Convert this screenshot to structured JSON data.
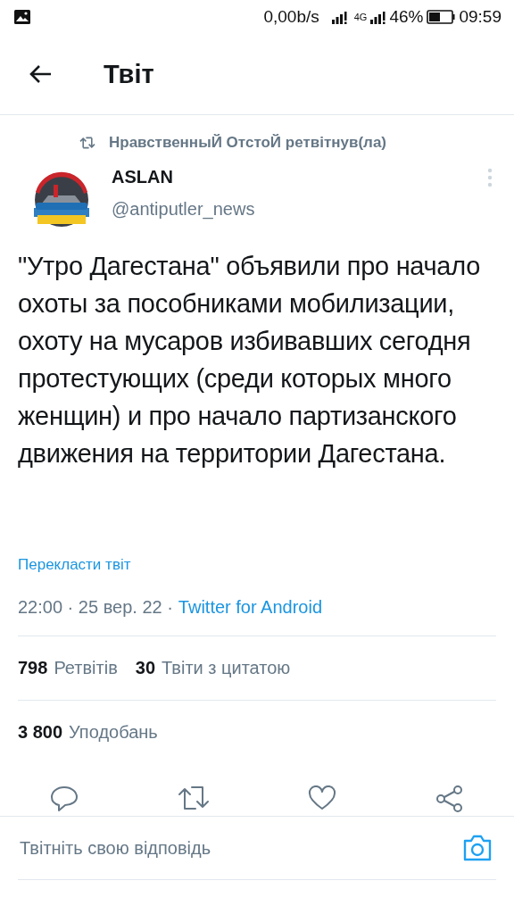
{
  "status_bar": {
    "net_speed": "0,00b/s",
    "network_type": "4G",
    "battery_percent": "46%",
    "time": "09:59"
  },
  "header": {
    "title": "Твіт"
  },
  "tweet": {
    "retweeted_by": "НравственныЙ ОтстоЙ ретвітнув(ла)",
    "author": {
      "name": "ASLAN",
      "handle": "@antiputler_news"
    },
    "text": "\"Утро Дагестана\" объявили про начало охоты за пособниками мобилизации, охоту на мусаров избивавших сегодня протестующих (среди которых много женщин) и про начало партизанского движения на территории Дагестана.",
    "translate_link": "Перекласти твіт",
    "posted": "22:00 · 25 вер. 22 ·",
    "source": "Twitter for Android",
    "stats": [
      {
        "count": "798",
        "label": "Ретвітів"
      },
      {
        "count": "30",
        "label": "Твіти з цитатою"
      }
    ],
    "likes": {
      "count": "3 800",
      "label": "Уподобань"
    }
  },
  "reply": {
    "placeholder": "Твітніть свою відповідь"
  }
}
